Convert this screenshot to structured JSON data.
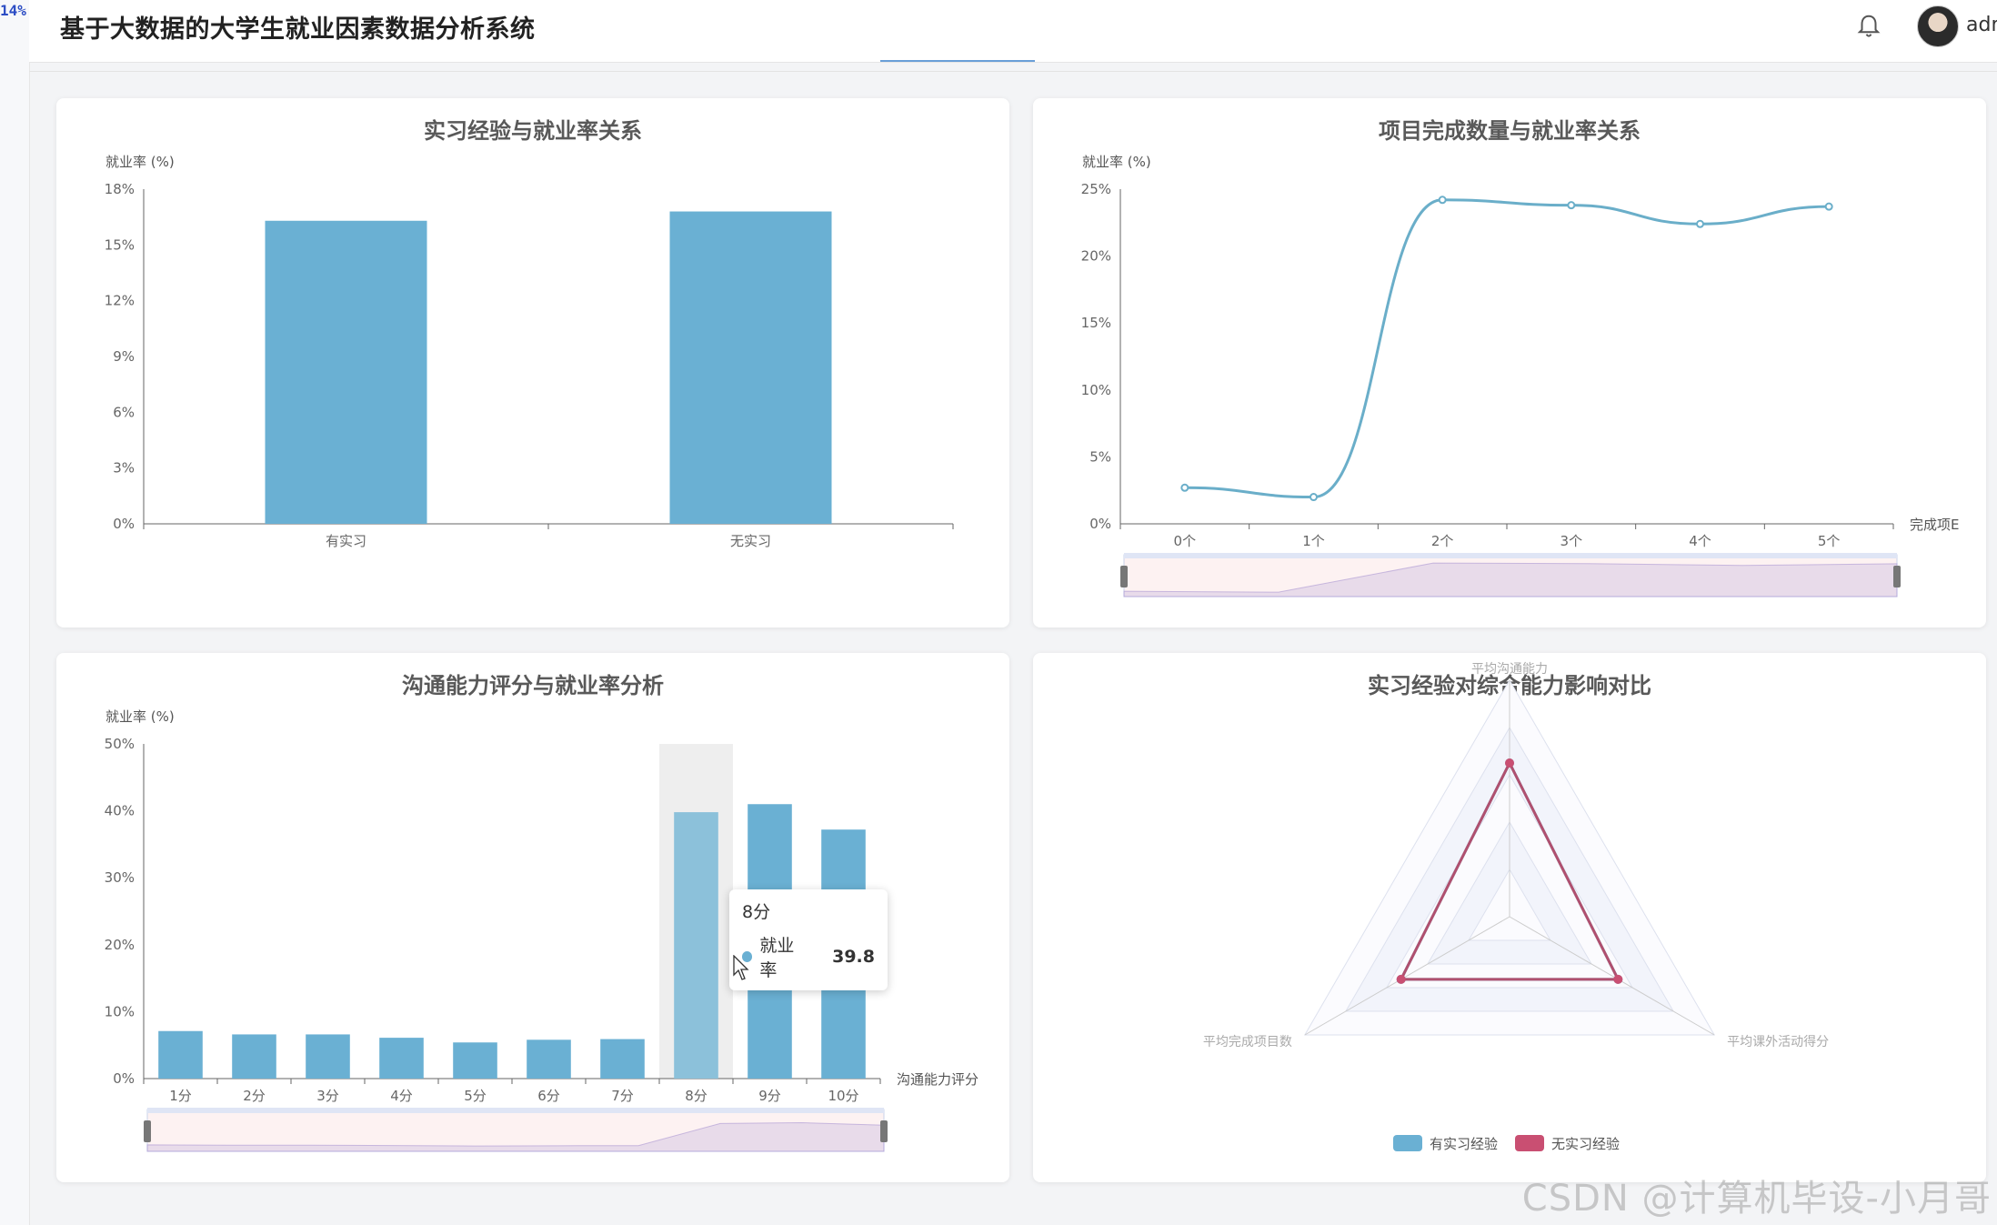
{
  "header": {
    "corner_badge": "14%",
    "title": "基于大数据的大学生就业因素数据分析系统",
    "username": "admin",
    "icons": {
      "notification": "bell-icon",
      "avatar": "user-avatar"
    }
  },
  "colors": {
    "bar": "#6ab0d3",
    "line": "#6aaec9",
    "no_intern": "#c94f72",
    "highlight_bar": "#8cc1da"
  },
  "charts": {
    "internship": {
      "chart_data": {
        "type": "bar",
        "title": "实习经验与就业率关系",
        "ylabel": "就业率 (%)",
        "categories": [
          "有实习",
          "无实习"
        ],
        "values": [
          16.3,
          16.8
        ],
        "ylim": [
          0,
          18
        ],
        "yticks": [
          "0%",
          "3%",
          "6%",
          "9%",
          "12%",
          "15%",
          "18%"
        ]
      }
    },
    "projects": {
      "chart_data": {
        "type": "line",
        "title": "项目完成数量与就业率关系",
        "ylabel": "就业率 (%)",
        "xlabel": "完成项E",
        "categories": [
          "0个",
          "1个",
          "2个",
          "3个",
          "4个",
          "5个"
        ],
        "values": [
          2.7,
          2.0,
          24.2,
          23.8,
          22.4,
          23.7
        ],
        "ylim": [
          0,
          25
        ],
        "yticks": [
          "0%",
          "5%",
          "10%",
          "15%",
          "20%",
          "25%"
        ],
        "smooth": true,
        "datazoom": true
      }
    },
    "communication": {
      "chart_data": {
        "type": "bar",
        "title": "沟通能力评分与就业率分析",
        "ylabel": "就业率 (%)",
        "xlabel": "沟通能力评分",
        "categories": [
          "1分",
          "2分",
          "3分",
          "4分",
          "5分",
          "6分",
          "7分",
          "8分",
          "9分",
          "10分"
        ],
        "values": [
          7.1,
          6.6,
          6.6,
          6.1,
          5.4,
          5.8,
          5.9,
          39.8,
          41.0,
          37.2
        ],
        "ylim": [
          0,
          50
        ],
        "yticks": [
          "0%",
          "10%",
          "20%",
          "30%",
          "40%",
          "50%"
        ],
        "highlight_index": 7,
        "datazoom": true,
        "tooltip": {
          "category": "8分",
          "series": "就业率",
          "value": "39.8"
        }
      }
    },
    "radar": {
      "chart_data": {
        "type": "radar",
        "title": "实习经验对综合能力影响对比",
        "indicators": [
          "平均沟通能力",
          "平均课外活动得分",
          "平均完成项目数"
        ],
        "series": [
          {
            "name": "有实习经验",
            "values": [
              0.65,
              0.53,
              0.53
            ]
          },
          {
            "name": "无实习经验",
            "values": [
              0.65,
              0.53,
              0.53
            ]
          }
        ]
      }
    }
  },
  "watermark": "CSDN @计算机毕设-小月哥"
}
